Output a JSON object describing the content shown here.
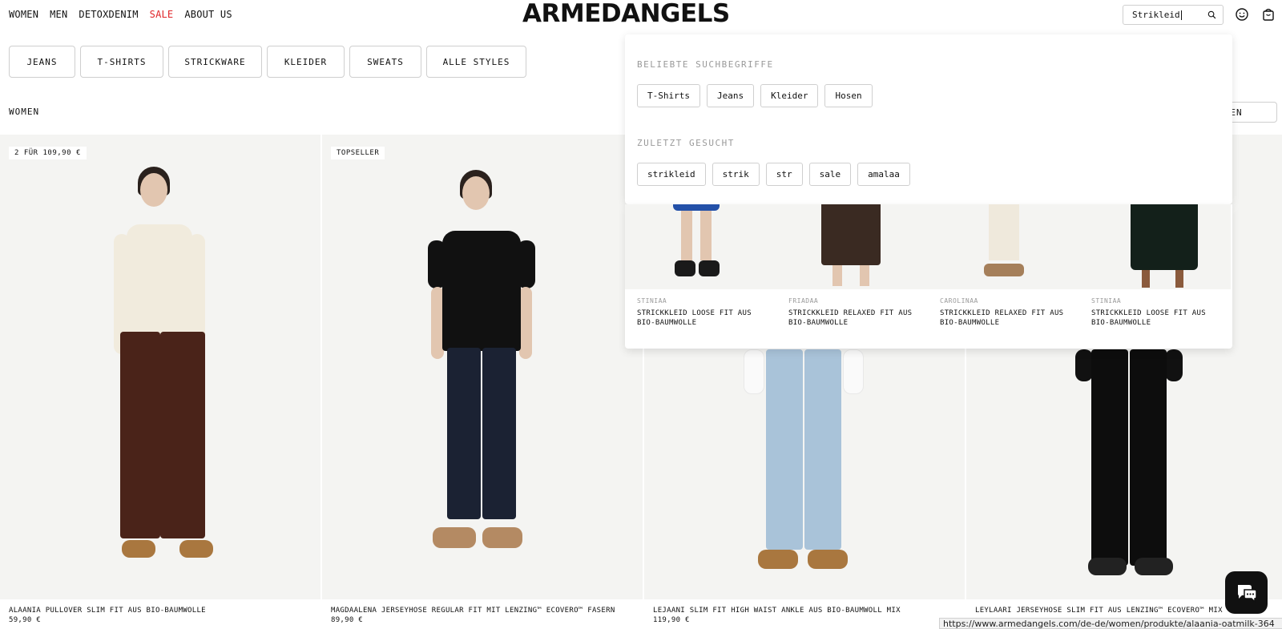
{
  "header": {
    "nav": [
      "WOMEN",
      "MEN",
      "DETOXDENIM",
      "SALE",
      "ABOUT US"
    ],
    "logo": "ARMEDANGELS",
    "search_value": "Strikleid"
  },
  "categories": [
    "JEANS",
    "T-SHIRTS",
    "STRICKWARE",
    "KLEIDER",
    "SWEATS",
    "ALLE STYLES"
  ],
  "breadcrumb": "WOMEN",
  "sort_label": "SORTIEREN",
  "products": [
    {
      "badge": "2 FÜR 109,90 €",
      "name": "ALAANIA PULLOVER SLIM FIT AUS BIO-BAUMWOLLE",
      "price": "59,90 €"
    },
    {
      "badge": "TOPSELLER",
      "name": "MAGDAALENA JERSEYHOSE REGULAR FIT MIT LENZING™ ECOVERO™ FASERN",
      "price": "89,90 €"
    },
    {
      "badge": "",
      "name": "LEJAANI SLIM FIT HIGH WAIST ANKLE AUS BIO-BAUMWOLL MIX",
      "price": "119,90 €"
    },
    {
      "badge": "",
      "name": "LEYLAARI JERSEYHOSE SLIM FIT AUS LENZING™ ECOVERO™ MIX",
      "price": ""
    }
  ],
  "search_dropdown": {
    "popular_heading": "BELIEBTE SUCHBEGRIFFE",
    "popular": [
      "T-Shirts",
      "Jeans",
      "Kleider",
      "Hosen"
    ],
    "recent_heading": "ZULETZT GESUCHT",
    "recent": [
      "strikleid",
      "strik",
      "str",
      "sale",
      "amalaa"
    ],
    "suggestions": [
      {
        "brand": "STINIAA",
        "title": "STRICKKLEID LOOSE FIT AUS BIO-BAUMWOLLE"
      },
      {
        "brand": "FRIADAA",
        "title": "STRICKKLEID RELAXED FIT AUS BIO-BAUMWOLLE"
      },
      {
        "brand": "CAROLINAA",
        "title": "STRICKKLEID RELAXED FIT AUS BIO-BAUMWOLLE"
      },
      {
        "brand": "STINIAA",
        "title": "STRICKKLEID LOOSE FIT AUS BIO-BAUMWOLLE"
      }
    ]
  },
  "status_url": "https://www.armedangels.com/de-de/women/produkte/alaania-oatmilk-364",
  "colors": {
    "sale": "#e0262a",
    "text": "#111111",
    "muted": "#9a9a9a",
    "border": "#cfcfcf"
  },
  "icons": [
    "search-icon",
    "account-icon",
    "cart-icon",
    "chat-icon"
  ]
}
